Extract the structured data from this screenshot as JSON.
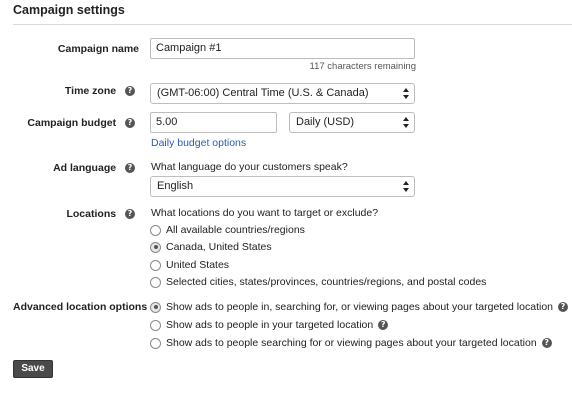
{
  "page": {
    "title": "Campaign settings"
  },
  "icons": {
    "help": "?",
    "help_icon_name": "question-mark-circle-icon",
    "select_arrows_icon_name": "select-updown-arrows-icon"
  },
  "colors": {
    "link": "#2a5db0",
    "save_button_bg": "#4a4a4a",
    "help_icon_bg": "#555555"
  },
  "campaign_name": {
    "label": "Campaign name",
    "value": "Campaign #1",
    "remaining": "117 characters remaining"
  },
  "time_zone": {
    "label": "Time zone",
    "selected": "(GMT-06:00) Central Time (U.S. & Canada)"
  },
  "campaign_budget": {
    "label": "Campaign budget",
    "value": "5.00",
    "period_selected": "Daily (USD)",
    "options_link": "Daily budget options"
  },
  "ad_language": {
    "label": "Ad language",
    "question": "What language do your customers speak?",
    "selected": "English"
  },
  "locations": {
    "label": "Locations",
    "question": "What locations do you want to target or exclude?",
    "options": [
      {
        "label": "All available countries/regions",
        "checked": false
      },
      {
        "label": "Canada, United States",
        "checked": true
      },
      {
        "label": "United States",
        "checked": false
      },
      {
        "label": "Selected cities, states/provinces, countries/regions, and postal codes",
        "checked": false
      }
    ]
  },
  "advanced_location_options": {
    "label": "Advanced location options",
    "options": [
      {
        "label": "Show ads to people in, searching for, or viewing pages about your targeted location",
        "checked": true
      },
      {
        "label": "Show ads to people in your targeted location",
        "checked": false
      },
      {
        "label": "Show ads to people searching for or viewing pages about your targeted location",
        "checked": false
      }
    ]
  },
  "actions": {
    "save_label": "Save"
  }
}
